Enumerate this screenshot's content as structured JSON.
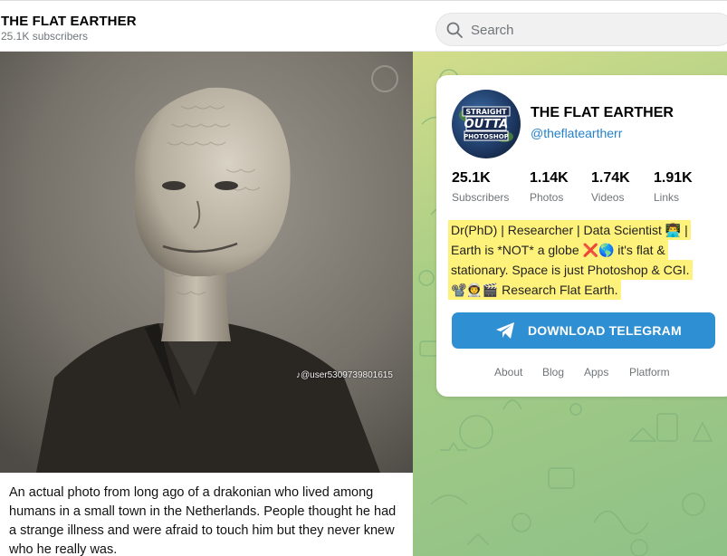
{
  "header": {
    "channel_title": "THE FLAT EARTHER",
    "subscribers": "25.1K subscribers",
    "search_placeholder": "Search"
  },
  "post": {
    "watermark": "@user5309739801615",
    "caption": "An actual photo from long ago of a drakonian who lived among humans in a small town in the Netherlands. People thought he had a strange illness and were afraid to touch him but they never knew who he really was."
  },
  "profile": {
    "avatar_text": [
      "STRAIGHT",
      "OUTTA",
      "PHOTOSHOP"
    ],
    "name": "THE FLAT EARTHER",
    "handle": "@theflateartherr",
    "stats": [
      {
        "value": "25.1K",
        "label": "Subscribers"
      },
      {
        "value": "1.14K",
        "label": "Photos"
      },
      {
        "value": "1.74K",
        "label": "Videos"
      },
      {
        "value": "1.91K",
        "label": "Links"
      }
    ],
    "bio_lines": [
      "Dr(PhD) | Researcher | Data Scientist 👨‍💻 |",
      "Earth is *NOT* a globe ❌🌎  it's flat &",
      "stationary. Space is just Photoshop & CGI.",
      "📽️👨‍🚀🎬 Research Flat Earth."
    ],
    "download_label": "DOWNLOAD TELEGRAM",
    "footer_links": [
      "About",
      "Blog",
      "Apps",
      "Platform"
    ]
  },
  "colors": {
    "accent_blue": "#2f8fd3",
    "handle_blue": "#2481cc",
    "highlight": "#fff27a",
    "pattern_green": "#a7cd86"
  }
}
